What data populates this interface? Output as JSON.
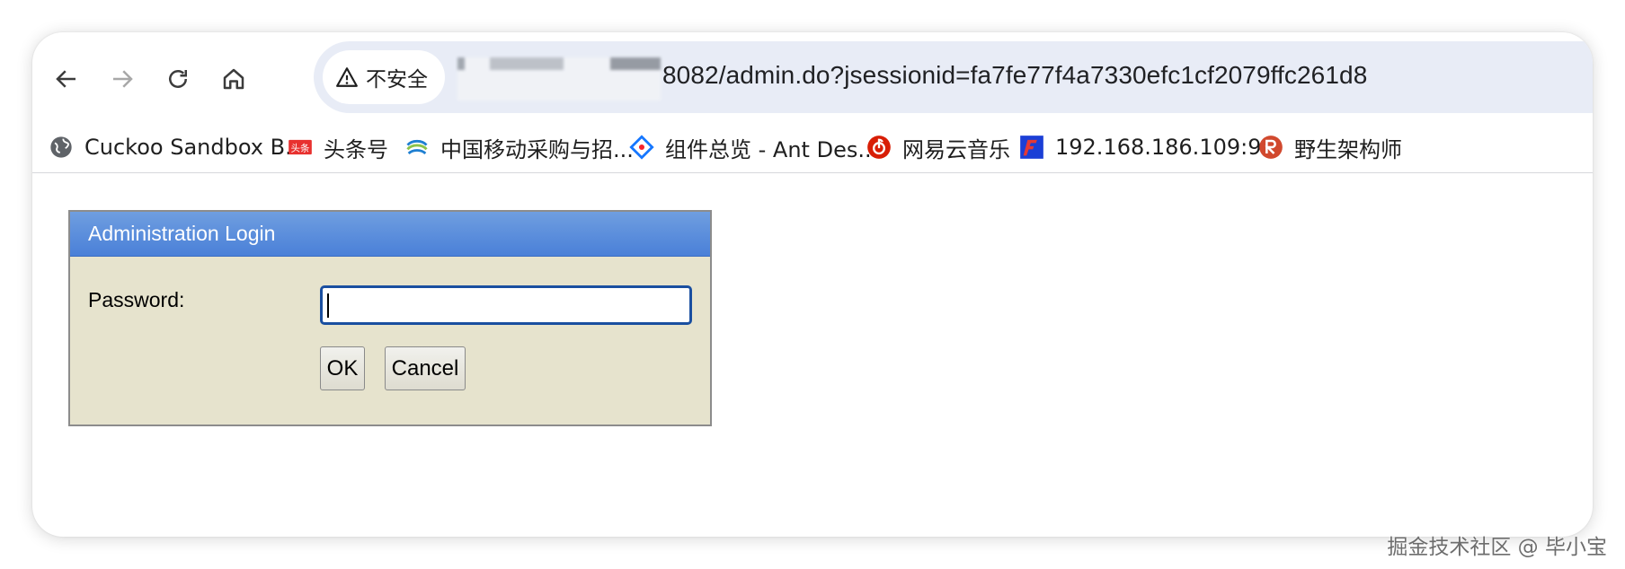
{
  "browser": {
    "security_label": "不安全",
    "url_visible": "8082/admin.do?jsessionid=fa7fe77f4a7330efc1cf2079ffc261d8",
    "icons": {
      "back": "arrow-left-icon",
      "forward": "arrow-right-icon",
      "reload": "reload-icon",
      "home": "home-icon",
      "security": "warning-triangle-icon"
    }
  },
  "bookmarks": [
    {
      "label": "Cuckoo Sandbox B...",
      "icon": "globe-icon"
    },
    {
      "label": "头条号",
      "icon": "toutiao-icon"
    },
    {
      "label": "中国移动采购与招...",
      "icon": "china-mobile-icon"
    },
    {
      "label": "组件总览 - Ant Des...",
      "icon": "ant-design-icon"
    },
    {
      "label": "网易云音乐",
      "icon": "netease-music-icon"
    },
    {
      "label": "192.168.186.109:9...",
      "icon": "app-icon"
    },
    {
      "label": "野生架构师",
      "icon": "r-logo-icon"
    }
  ],
  "login": {
    "title": "Administration Login",
    "password_label": "Password:",
    "password_value": "",
    "ok_label": "OK",
    "cancel_label": "Cancel"
  },
  "watermark": "掘金技术社区 @ 毕小宝",
  "colors": {
    "panel_header": "#5b8fdc",
    "panel_body": "#e6e3cd",
    "focus_border": "#1a4fa0",
    "omnibox": "#e8ecf6"
  }
}
